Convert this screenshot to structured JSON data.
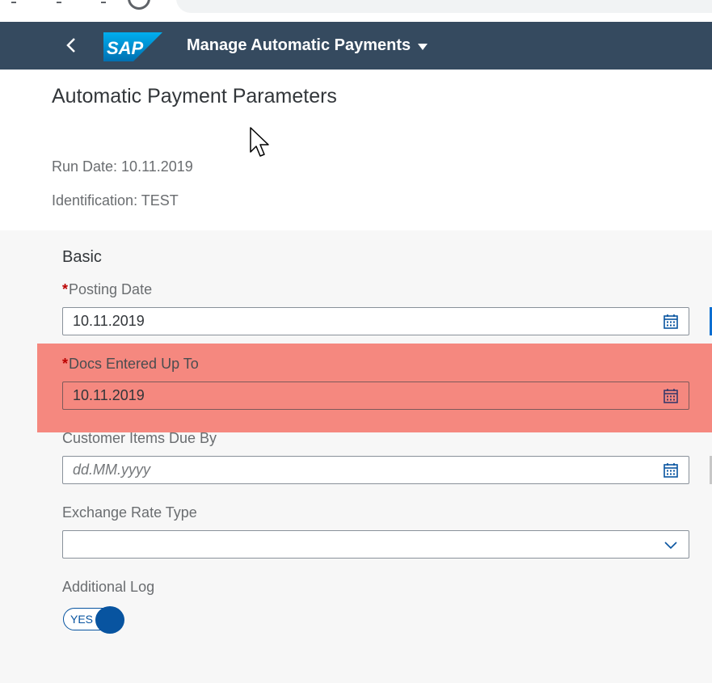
{
  "shell": {
    "app_title": "Manage Automatic Payments",
    "logo_text": "SAP",
    "brand_color": "#354a5f"
  },
  "header": {
    "page_title": "Automatic Payment Parameters",
    "run_date": "Run Date: 10.11.2019",
    "identification": "Identification: TEST"
  },
  "form": {
    "section_title": "Basic",
    "required_marker": "*",
    "posting_date": {
      "label": "Posting Date",
      "value": "10.11.2019"
    },
    "docs_entered_up_to": {
      "label": "Docs Entered Up To",
      "value": "10.11.2019"
    },
    "customer_items_due_by": {
      "label": "Customer Items Due By",
      "placeholder": "dd.MM.yyyy"
    },
    "exchange_rate_type": {
      "label": "Exchange Rate Type",
      "value": ""
    },
    "additional_log": {
      "label": "Additional Log",
      "toggle_text": "YES"
    }
  },
  "icons": {
    "back": "chevron-left-icon",
    "calendar": "calendar-icon",
    "dropdown": "chevron-down-icon"
  },
  "colors": {
    "accent": "#0854a0",
    "required": "#bb0000",
    "highlight": "#f48080"
  }
}
